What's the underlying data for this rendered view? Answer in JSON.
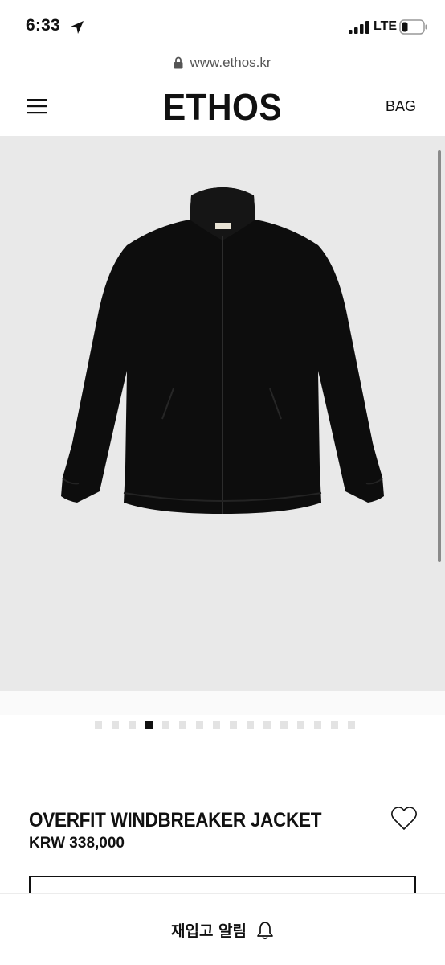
{
  "status_bar": {
    "time": "6:33",
    "network": "LTE"
  },
  "browser": {
    "url": "www.ethos.kr"
  },
  "header": {
    "brand": "ETHOS",
    "bag_label": "BAG"
  },
  "gallery": {
    "image_count": 16,
    "active_index": 3
  },
  "product": {
    "name": "OVERFIT WINDBREAKER JACKET",
    "price": "KRW 338,000"
  },
  "bottom_bar": {
    "restock_label": "재입고 알림"
  },
  "icons": {
    "location": "location-arrow-icon",
    "signal": "signal-bars-icon",
    "battery": "battery-icon",
    "lock": "lock-icon",
    "menu": "hamburger-menu-icon",
    "wishlist": "heart-icon",
    "bell": "bell-icon"
  },
  "colors": {
    "gallery_background": "#e9e9e9",
    "text": "#111111",
    "inactive_dot": "#e3e3e3"
  }
}
